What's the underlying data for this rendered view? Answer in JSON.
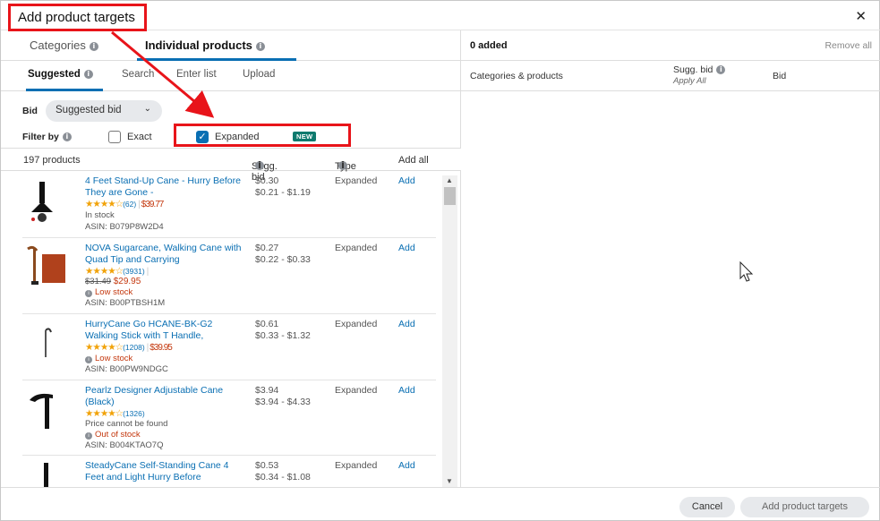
{
  "modal": {
    "title": "Add product targets",
    "close_glyph": "✕"
  },
  "tabs_main": [
    {
      "label": "Categories",
      "active": false
    },
    {
      "label": "Individual products",
      "active": true
    }
  ],
  "tabs_sub": [
    {
      "label": "Suggested",
      "active": true
    },
    {
      "label": "Search",
      "active": false
    },
    {
      "label": "Enter list",
      "active": false
    },
    {
      "label": "Upload",
      "active": false
    }
  ],
  "bid": {
    "label": "Bid",
    "selected": "Suggested bid"
  },
  "filter": {
    "label": "Filter by",
    "exact_label": "Exact",
    "exact_checked": false,
    "expanded_label": "Expanded",
    "expanded_checked": true,
    "new_badge": "NEW"
  },
  "list_header": {
    "count": "197 products",
    "sugg_bid": "Sugg. bid",
    "type": "Type",
    "add_all": "Add all"
  },
  "products": [
    {
      "name": "4 Feet Stand-Up Cane - Hurry Before They are Gone -",
      "stars": "★★★★☆",
      "reviews": "(62)",
      "price": "$39.77",
      "old_price": "",
      "availability": "In stock",
      "asin": "ASIN: B079P8W2D4",
      "bid": "$0.30",
      "range": "$0.21 - $1.19",
      "type": "Expanded",
      "add": "Add"
    },
    {
      "name": "NOVA Sugarcane, Walking Cane with Quad Tip and Carrying",
      "stars": "★★★★☆",
      "reviews": "(3931)",
      "price": "$29.95",
      "old_price": "$31.49",
      "availability": "Low stock",
      "asin": "ASIN: B00PTBSH1M",
      "bid": "$0.27",
      "range": "$0.22 - $0.33",
      "type": "Expanded",
      "add": "Add"
    },
    {
      "name": "HurryCane Go HCANE-BK-G2 Walking Stick with T Handle,",
      "stars": "★★★★☆",
      "reviews": "(1208)",
      "price": "$39.95",
      "old_price": "",
      "availability": "Low stock",
      "asin": "ASIN: B00PW9NDGC",
      "bid": "$0.61",
      "range": "$0.33 - $1.32",
      "type": "Expanded",
      "add": "Add"
    },
    {
      "name": "Pearlz Designer Adjustable Cane (Black)",
      "stars": "★★★★☆",
      "reviews": "(1326)",
      "price": "",
      "old_price": "",
      "price_note": "Price cannot be found",
      "availability": "Out of stock",
      "asin": "ASIN: B004KTAO7Q",
      "bid": "$3.94",
      "range": "$3.94 - $4.33",
      "type": "Expanded",
      "add": "Add"
    },
    {
      "name": "SteadyCane Self-Standing Cane 4 Feet and Light Hurry Before",
      "bid": "$0.53",
      "range": "$0.34 - $1.08",
      "type": "Expanded",
      "add": "Add"
    }
  ],
  "right": {
    "added": "0 added",
    "remove_all": "Remove all",
    "col_products": "Categories & products",
    "col_sugg": "Sugg. bid",
    "col_sugg_sub": "Apply All",
    "col_bid": "Bid"
  },
  "footer": {
    "cancel": "Cancel",
    "submit": "Add product targets"
  },
  "colors": {
    "accent": "#0a6fb3",
    "annotation": "#e8141a",
    "warning": "#c4380e",
    "star": "#f1a208"
  }
}
